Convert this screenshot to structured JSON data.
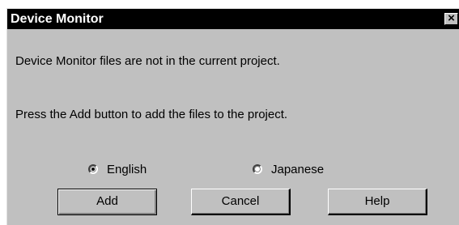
{
  "dialog": {
    "title": "Device Monitor",
    "close_glyph": "×",
    "close_icon": "close-icon",
    "message_line1": "Device Monitor files are not in the current project.",
    "message_line2": "Press the Add button to add the files to the project.",
    "language_options": [
      {
        "label": "English",
        "selected": true
      },
      {
        "label": "Japanese",
        "selected": false
      }
    ],
    "buttons": {
      "add": "Add",
      "cancel": "Cancel",
      "help": "Help"
    }
  }
}
